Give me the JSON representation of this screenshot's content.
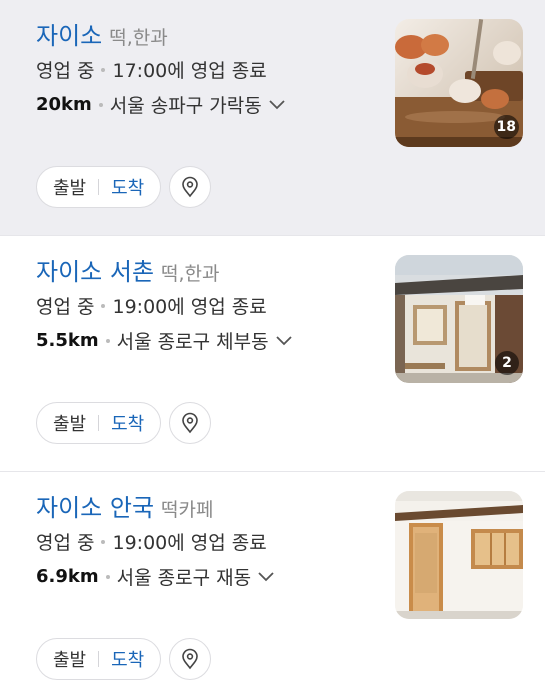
{
  "results": [
    {
      "name": "자이소",
      "category": "떡,한과",
      "status": "영업 중",
      "hours": "17:00에 영업 종료",
      "distance": "20km",
      "address": "서울 송파구 가락동",
      "photo_count": "18",
      "route_from": "출발",
      "route_to": "도착"
    },
    {
      "name": "자이소 서촌",
      "category": "떡,한과",
      "status": "영업 중",
      "hours": "19:00에 영업 종료",
      "distance": "5.5km",
      "address": "서울 종로구 체부동",
      "photo_count": "2",
      "route_from": "출발",
      "route_to": "도착"
    },
    {
      "name": "자이소 안국",
      "category": "떡카페",
      "status": "영업 중",
      "hours": "19:00에 영업 종료",
      "distance": "6.9km",
      "address": "서울 종로구 재동",
      "route_from": "출발",
      "route_to": "도착"
    }
  ],
  "icons": {
    "expand": "chevron-down-icon",
    "map_pin": "map-pin-icon"
  },
  "colors": {
    "link_blue": "#1a66b8",
    "highlight_bg": "#eeeef2"
  }
}
